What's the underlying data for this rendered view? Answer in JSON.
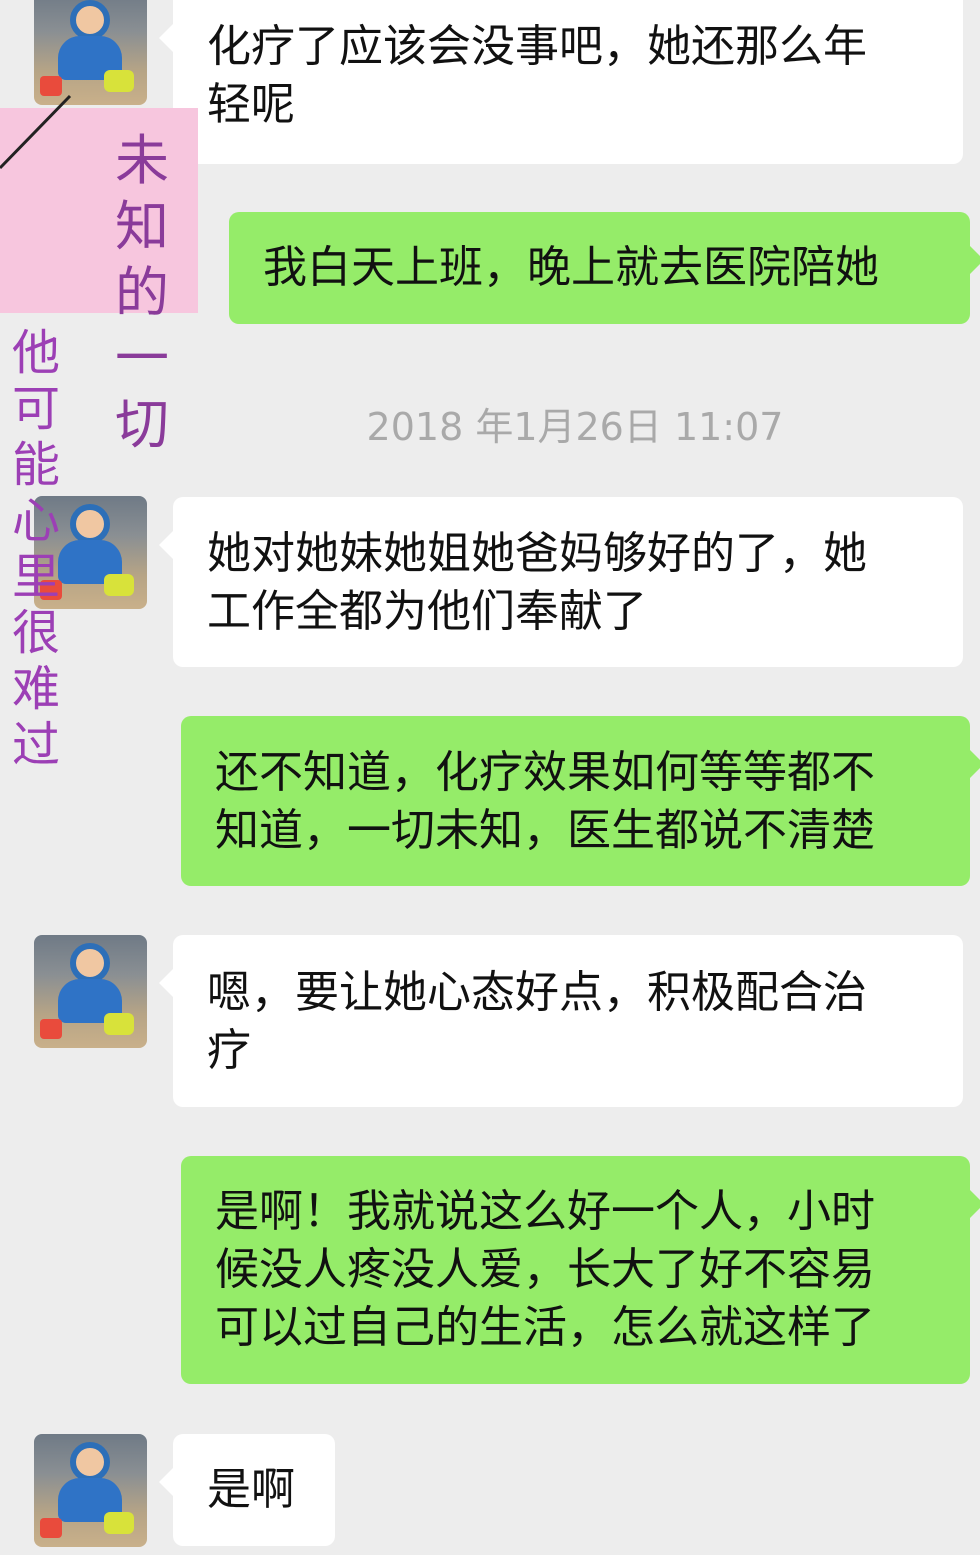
{
  "messages": [
    {
      "dir": "in",
      "text": "化疗了应该会没事吧，她还那么年\n轻呢"
    },
    {
      "dir": "out",
      "text": "我白天上班，晚上就去医院陪她"
    },
    {
      "dir": "in",
      "text": "她对她妹她姐她爸妈够好的了，她\n工作全都为他们奉献了"
    },
    {
      "dir": "out",
      "text": "还不知道，化疗效果如何等等都不\n知道，一切未知，医生都说不清楚"
    },
    {
      "dir": "in",
      "text": "嗯，要让她心态好点，积极配合治\n疗"
    },
    {
      "dir": "out",
      "text": "是啊！我就说这么好一个人，小时\n候没人疼没人爱，长大了好不容易\n可以过自己的生活，怎么就这样了"
    },
    {
      "dir": "in",
      "text": "是啊"
    }
  ],
  "timestamp": "2018 年1月26日 11:07",
  "annotations": {
    "handwritten": "未\n知\n的\n一\n切",
    "side_note": "他\n可\n能\n心\n里\n很\n难\n过"
  },
  "colors": {
    "background": "#ededed",
    "incoming_bubble": "#ffffff",
    "outgoing_bubble": "#95ec69",
    "timestamp": "#a9a9a9",
    "annotation_purple": "#9c3fb5",
    "sticky_pink": "#f7c6de"
  },
  "icons": {
    "avatar": "child-avatar-icon"
  }
}
